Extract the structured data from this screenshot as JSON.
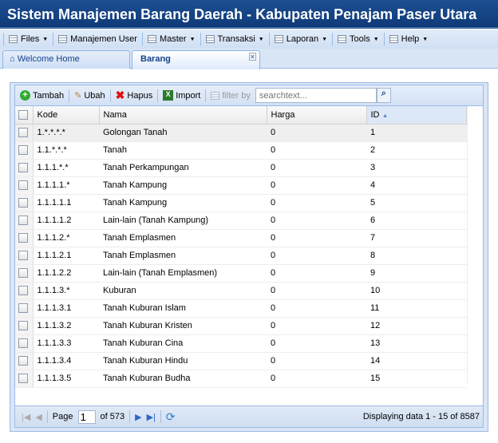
{
  "app_title": "Sistem Manajemen Barang Daerah - Kabupaten Penajam Paser Utara",
  "menu": [
    {
      "label": "Files",
      "dropdown": true
    },
    {
      "label": "Manajemen User",
      "dropdown": false
    },
    {
      "label": "Master",
      "dropdown": true
    },
    {
      "label": "Transaksi",
      "dropdown": true
    },
    {
      "label": "Laporan",
      "dropdown": true
    },
    {
      "label": "Tools",
      "dropdown": true
    },
    {
      "label": "Help",
      "dropdown": true
    }
  ],
  "tabs": [
    {
      "label": "Welcome Home"
    },
    {
      "label": "Barang",
      "active": true
    }
  ],
  "toolbar": {
    "add": "Tambah",
    "edit": "Ubah",
    "delete": "Hapus",
    "import": "Import",
    "filter_label": "filter by",
    "search_placeholder": "searchtext..."
  },
  "columns": [
    "Kode",
    "Nama",
    "Harga",
    "ID"
  ],
  "rows": [
    [
      "1.*.*.*.*",
      "Golongan Tanah",
      "0",
      "1"
    ],
    [
      "1.1.*.*.*",
      "Tanah",
      "0",
      "2"
    ],
    [
      "1.1.1.*.*",
      "Tanah Perkampungan",
      "0",
      "3"
    ],
    [
      "1.1.1.1.*",
      "Tanah Kampung",
      "0",
      "4"
    ],
    [
      "1.1.1.1.1",
      "Tanah Kampung",
      "0",
      "5"
    ],
    [
      "1.1.1.1.2",
      "Lain-lain (Tanah Kampung)",
      "0",
      "6"
    ],
    [
      "1.1.1.2.*",
      "Tanah Emplasmen",
      "0",
      "7"
    ],
    [
      "1.1.1.2.1",
      "Tanah Emplasmen",
      "0",
      "8"
    ],
    [
      "1.1.1.2.2",
      "Lain-lain (Tanah Emplasmen)",
      "0",
      "9"
    ],
    [
      "1.1.1.3.*",
      "Kuburan",
      "0",
      "10"
    ],
    [
      "1.1.1.3.1",
      "Tanah Kuburan Islam",
      "0",
      "11"
    ],
    [
      "1.1.1.3.2",
      "Tanah Kuburan Kristen",
      "0",
      "12"
    ],
    [
      "1.1.1.3.3",
      "Tanah Kuburan Cina",
      "0",
      "13"
    ],
    [
      "1.1.1.3.4",
      "Tanah Kuburan Hindu",
      "0",
      "14"
    ],
    [
      "1.1.1.3.5",
      "Tanah Kuburan Budha",
      "0",
      "15"
    ]
  ],
  "pager": {
    "page_label": "Page",
    "page": "1",
    "of_label": "of 573",
    "display": "Displaying data 1 - 15 of 8587"
  }
}
